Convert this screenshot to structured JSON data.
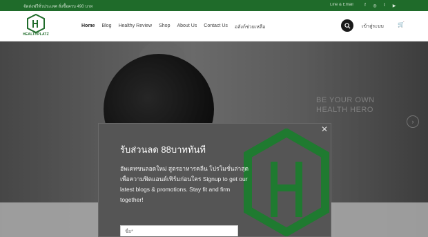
{
  "topbar": {
    "announce": "จัดส่งฟรีทั่วประเทศ สั่งซื้อครบ 490 บาท",
    "contact": "Line & Email",
    "social_icons": [
      "facebook-icon",
      "instagram-icon",
      "twitter-icon",
      "youtube-icon"
    ]
  },
  "header": {
    "brand": "HEALTHPLATZ",
    "nav": [
      "Home",
      "Blog",
      "Healthy Review",
      "Shop",
      "About Us",
      "Contact Us",
      "อลังก์ช่วยเหลือ"
    ],
    "login": "เข้าสู่ระบบ",
    "cart_icon": "cart-icon"
  },
  "hero": {
    "tagline_1": "BE YOUR OWN",
    "tagline_2": "HEALTH HERO"
  },
  "popup": {
    "title": "รับส่วนลด 88บาททันที",
    "description": "อัพเดทขนลอดใหม่ สูตรอาหารคลีน โปรโมชั่นล่าสุดเพื่อความฟิตแอนด์เฟิร์มก่อนใคร Signup to get our latest blogs & promotions. Stay fit and firm together!",
    "name_placeholder": "ชื่อ*"
  },
  "colors": {
    "brand_green": "#1f6b2a",
    "popup_bg": "#555555"
  }
}
